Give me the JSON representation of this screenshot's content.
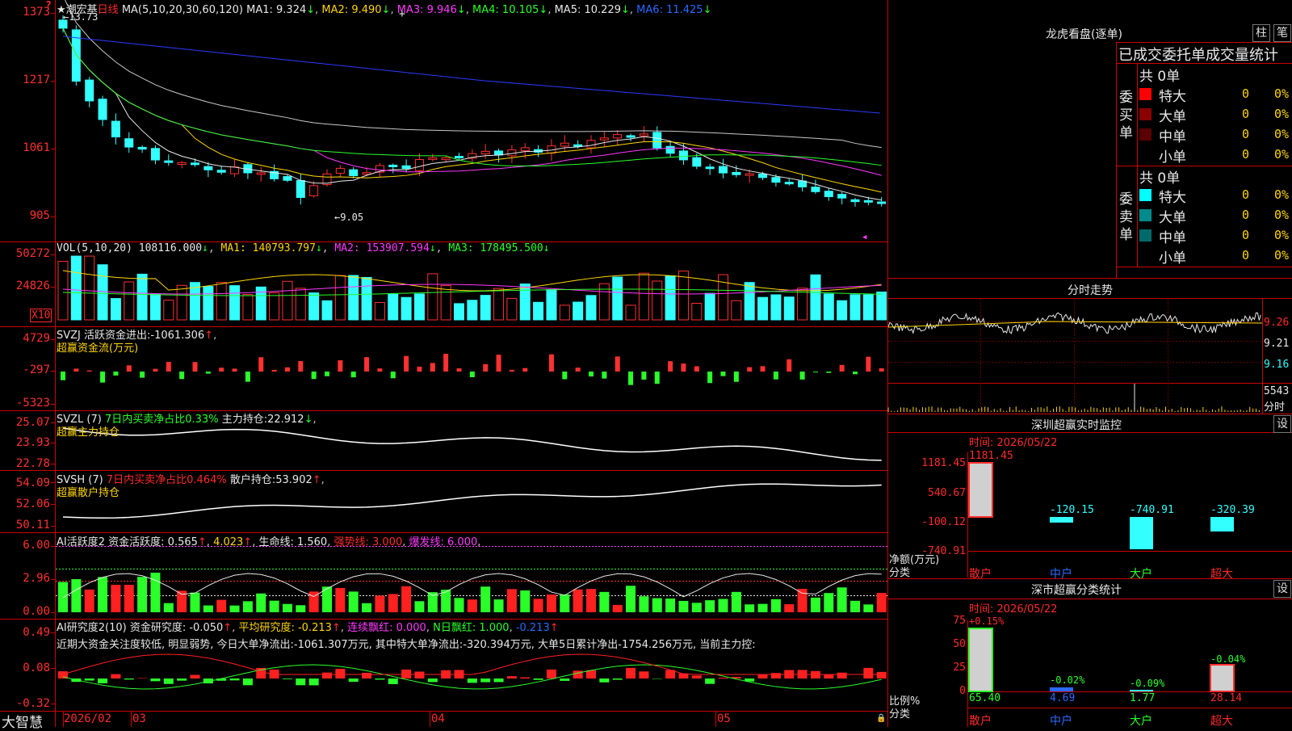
{
  "main": {
    "stock_name": "★潮宏基",
    "period": "日线",
    "ma_label": "MA(5,10,20,30,60,120)",
    "ma": [
      {
        "name": "MA1",
        "value": "9.324",
        "color": "#e8e8e8"
      },
      {
        "name": "MA2",
        "value": "9.490",
        "color": "#ffd600"
      },
      {
        "name": "MA3",
        "value": "9.946",
        "color": "#ff38ff"
      },
      {
        "name": "MA4",
        "value": "10.105",
        "color": "#2aff2a"
      },
      {
        "name": "MA5",
        "value": "10.229",
        "color": "#c8c8c8"
      },
      {
        "name": "MA6",
        "value": "11.425",
        "color": "#2a6aff"
      }
    ],
    "high_mark": "13.73",
    "low_mark": "9.05",
    "yticks": [
      "1373",
      "1217",
      "1061",
      "905"
    ]
  },
  "volume": {
    "label": "VOL(5,10,20)",
    "value": "108116.000",
    "ma": [
      {
        "name": "MA1",
        "value": "140793.797"
      },
      {
        "name": "MA2",
        "value": "153907.594"
      },
      {
        "name": "MA3",
        "value": "178495.500"
      }
    ],
    "yticks": [
      "50272",
      "24826"
    ],
    "unit": "X10"
  },
  "svzj": {
    "label": "SVZJ",
    "desc": "活跃资金进出:",
    "value": "-1061.306",
    "subtitle": "超赢资金流(万元)",
    "yticks": [
      "4729",
      "-297",
      "-5323"
    ]
  },
  "svzl": {
    "label": "SVZL (7)",
    "desc": "7日内买卖净占比0.33%",
    "main_label": "主力持仓:",
    "main_value": "22.912",
    "subtitle": "超赢主力持仓",
    "yticks": [
      "25.07",
      "23.93",
      "22.78"
    ]
  },
  "svsh": {
    "label": "SVSH (7)",
    "desc": "7日内买卖净占比0.464%",
    "main_label": "散户持仓:",
    "main_value": "53.902",
    "subtitle": "超赢散户持仓",
    "yticks": [
      "54.09",
      "52.06",
      "50.11"
    ]
  },
  "ai_active": {
    "label": "AI活跃度2",
    "desc": "资金活跃度:",
    "value1": "0.565",
    "value2": "4.023",
    "life_label": "生命线:",
    "life_value": "1.560",
    "strong_label": "强势线:",
    "strong_value": "3.000",
    "burst_label": "爆发线:",
    "burst_value": "6.000",
    "yticks": [
      "6.00",
      "2.96",
      "0.00"
    ]
  },
  "ai_research": {
    "label": "AI研究度2(10)",
    "desc": "资金研究度:",
    "value": "-0.050",
    "avg_label": "平均研究度:",
    "avg_value": "-0.213",
    "red_label": "连续飘红:",
    "red_value": "0.000",
    "n_label": "N日飘红:",
    "n_value": "1.000",
    "extra_value": "-0.213",
    "comment": "近期大资金关注度较低, 明显弱势, 今日大单净流出:-1061.307万元, 其中特大单净流出:-320.394万元, 大单5日累计净出-1754.256万元, 当前主力控:",
    "yticks": [
      "0.49",
      "0.08",
      "-0.32"
    ]
  },
  "bottom": {
    "brand": "大智慧",
    "dates": [
      "2026/02",
      "03",
      "04",
      "05"
    ]
  },
  "dragon": {
    "title": "龙虎看盘(逐单)",
    "btn1": "柱",
    "btn2": "笔",
    "header": "已成交委托单成交量统计",
    "buy_label": "委买单",
    "sell_label": "委卖单",
    "buy_total": "共 0单",
    "sell_total": "共 0单",
    "buy_rows": [
      {
        "name": "特大",
        "val": "0",
        "pct": "0%",
        "color": "#ff0000"
      },
      {
        "name": "大单",
        "val": "0",
        "pct": "0%",
        "color": "#8b0000"
      },
      {
        "name": "中单",
        "val": "0",
        "pct": "0%",
        "color": "#5a0000"
      },
      {
        "name": "小单",
        "val": "0",
        "pct": "0%",
        "color": ""
      }
    ],
    "sell_rows": [
      {
        "name": "特大",
        "val": "0",
        "pct": "0%",
        "color": "#00ffff"
      },
      {
        "name": "大单",
        "val": "0",
        "pct": "0%",
        "color": "#008b8b"
      },
      {
        "name": "中单",
        "val": "0",
        "pct": "0%",
        "color": "#006a6a"
      },
      {
        "name": "小单",
        "val": "0",
        "pct": "0%",
        "color": ""
      }
    ]
  },
  "intraday": {
    "title": "分时走势",
    "yticks": [
      "9.26",
      "9.21",
      "9.16"
    ],
    "vol": "5543",
    "vol_label": "分时"
  },
  "monitor": {
    "title": "深圳超赢实时监控",
    "btn": "设",
    "time": "时间: 2026/05/22",
    "yticks": [
      "1181.45",
      "540.67",
      "-100.12",
      "-740.91"
    ],
    "ylabel1": "净额(万元)",
    "ylabel2": "分类",
    "categories": [
      "散户",
      "中户",
      "大户",
      "超大"
    ],
    "values": [
      "1181.45",
      "-120.15",
      "-740.91",
      "-320.39"
    ]
  },
  "classify": {
    "title": "深市超赢分类统计",
    "btn": "设",
    "time": "时间: 2026/05/22",
    "yticks": [
      "75",
      "50",
      "25",
      "0"
    ],
    "ylabel1": "比例%",
    "ylabel2": "分类",
    "categories": [
      "散户",
      "中户",
      "大户",
      "超大"
    ],
    "values": [
      "65.40",
      "4.69",
      "1.77",
      "28.14"
    ],
    "changes": [
      "+0.15%",
      "-0.02%",
      "-0.09%",
      "-0.04%"
    ]
  }
}
